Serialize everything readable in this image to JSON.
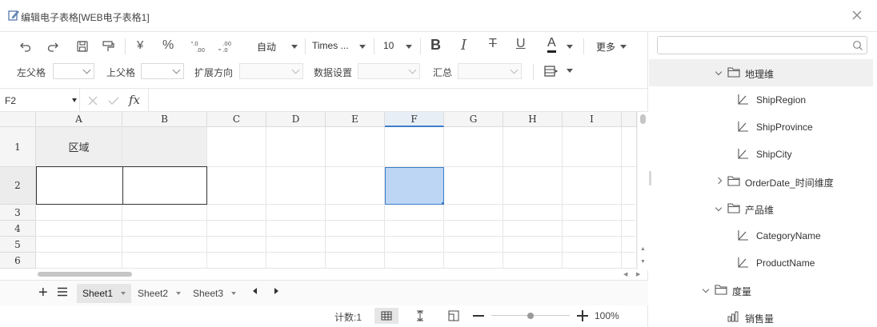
{
  "window": {
    "title": "编辑电子表格[WEB电子表格1]"
  },
  "toolbar": {
    "format_auto": "自动",
    "font_family": "Times ...",
    "font_size": "10",
    "more": "更多",
    "currency_symbol": "¥",
    "percent_symbol": "%",
    "bold": "B",
    "italic": "I",
    "strikethrough": "T",
    "underline": "U",
    "font_color": "A"
  },
  "toolbar2": {
    "left_parent": "左父格",
    "top_parent": "上父格",
    "expand_direction": "扩展方向",
    "data_settings": "数据设置",
    "summary": "汇总"
  },
  "formula_bar": {
    "cell_ref": "F2",
    "fx": "fx",
    "formula": ""
  },
  "sheet": {
    "columns": [
      "A",
      "B",
      "C",
      "D",
      "E",
      "F",
      "G",
      "H",
      "I"
    ],
    "active_column": "F",
    "rows": [
      "1",
      "2",
      "3",
      "4",
      "5",
      "6"
    ],
    "active_row": "2",
    "cells": {
      "A1": "区域",
      "B1": "",
      "A2": "",
      "B2": ""
    },
    "selected_cell": "F2"
  },
  "sheet_tabs": [
    "Sheet1",
    "Sheet2",
    "Sheet3"
  ],
  "active_sheet": "Sheet1",
  "status": {
    "count": "计数:1",
    "zoom": "100%",
    "zoom_level": 0.5
  },
  "panel": {
    "search_placeholder": "",
    "tree": [
      {
        "label": "地理维",
        "type": "folder",
        "expanded": true,
        "level": 1
      },
      {
        "label": "ShipRegion",
        "type": "level",
        "level": 2
      },
      {
        "label": "ShipProvince",
        "type": "level",
        "level": 2
      },
      {
        "label": "ShipCity",
        "type": "level",
        "level": 2
      },
      {
        "label": "OrderDate_时间维度",
        "type": "folder",
        "expanded": false,
        "level": 1
      },
      {
        "label": "产品维",
        "type": "folder",
        "expanded": true,
        "level": 1
      },
      {
        "label": "CategoryName",
        "type": "level",
        "level": 2
      },
      {
        "label": "ProductName",
        "type": "level",
        "level": 2
      },
      {
        "label": "度量",
        "type": "folder",
        "expanded": true,
        "level": 0
      },
      {
        "label": "销售量",
        "type": "measure",
        "level": 1
      }
    ]
  }
}
